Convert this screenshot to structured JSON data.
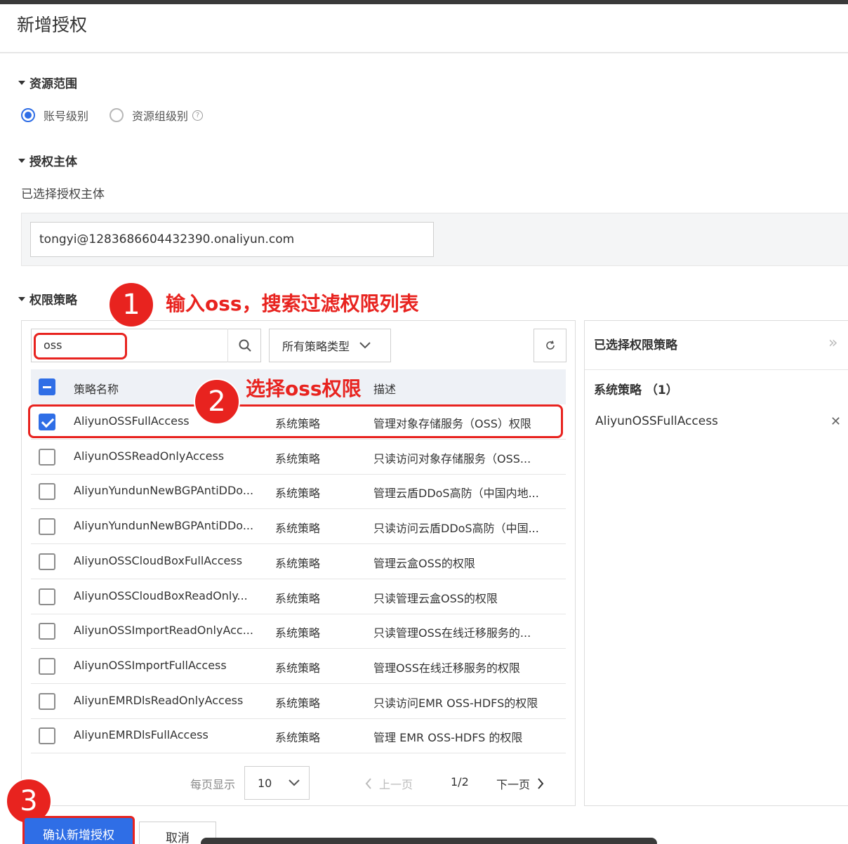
{
  "dialog": {
    "title": "新增授权"
  },
  "resource_scope": {
    "heading": "资源范围",
    "options": [
      {
        "label": "账号级别",
        "checked": true
      },
      {
        "label": "资源组级别",
        "checked": false
      }
    ],
    "help_icon": "?"
  },
  "principal": {
    "heading": "授权主体",
    "selected_label": "已选择授权主体",
    "value": "tongyi@1283686604432390.onaliyun.com"
  },
  "policies": {
    "heading": "权限策略",
    "search_value": "oss",
    "type_select": "所有策略类型",
    "columns": [
      "策略名称",
      "描述"
    ],
    "rows": [
      {
        "name": "AliyunOSSFullAccess",
        "type": "系统策略",
        "desc": "管理对象存储服务（OSS）权限",
        "checked": true
      },
      {
        "name": "AliyunOSSReadOnlyAccess",
        "type": "系统策略",
        "desc": "只读访问对象存储服务（OSS...",
        "checked": false
      },
      {
        "name": "AliyunYundunNewBGPAntiDDo...",
        "type": "系统策略",
        "desc": "管理云盾DDoS高防（中国内地...",
        "checked": false
      },
      {
        "name": "AliyunYundunNewBGPAntiDDo...",
        "type": "系统策略",
        "desc": "只读访问云盾DDoS高防（中国...",
        "checked": false
      },
      {
        "name": "AliyunOSSCloudBoxFullAccess",
        "type": "系统策略",
        "desc": "管理云盒OSS的权限",
        "checked": false
      },
      {
        "name": "AliyunOSSCloudBoxReadOnly...",
        "type": "系统策略",
        "desc": "只读管理云盒OSS的权限",
        "checked": false
      },
      {
        "name": "AliyunOSSImportReadOnlyAcc...",
        "type": "系统策略",
        "desc": "只读管理OSS在线迁移服务的...",
        "checked": false
      },
      {
        "name": "AliyunOSSImportFullAccess",
        "type": "系统策略",
        "desc": "管理OSS在线迁移服务的权限",
        "checked": false
      },
      {
        "name": "AliyunEMRDlsReadOnlyAccess",
        "type": "系统策略",
        "desc": "只读访问EMR OSS-HDFS的权限",
        "checked": false
      },
      {
        "name": "AliyunEMRDlsFullAccess",
        "type": "系统策略",
        "desc": "管理 EMR OSS-HDFS 的权限",
        "checked": false
      }
    ],
    "pager": {
      "per_page_label": "每页显示",
      "per_page": "10",
      "prev": "上一页",
      "page": "1/2",
      "next": "下一页"
    }
  },
  "selected_panel": {
    "title": "已选择权限策略",
    "group": "系统策略 （1）",
    "items": [
      "AliyunOSSFullAccess"
    ]
  },
  "annotations": {
    "step1_num": "1",
    "step1_text": "输入oss，搜索过滤权限列表",
    "step2_num": "2",
    "step2_text": "选择oss权限",
    "step3_num": "3"
  },
  "footer": {
    "confirm": "确认新增授权",
    "cancel": "取消"
  },
  "colors": {
    "accent": "#2f6ee6",
    "annotation": "#e8231f"
  }
}
